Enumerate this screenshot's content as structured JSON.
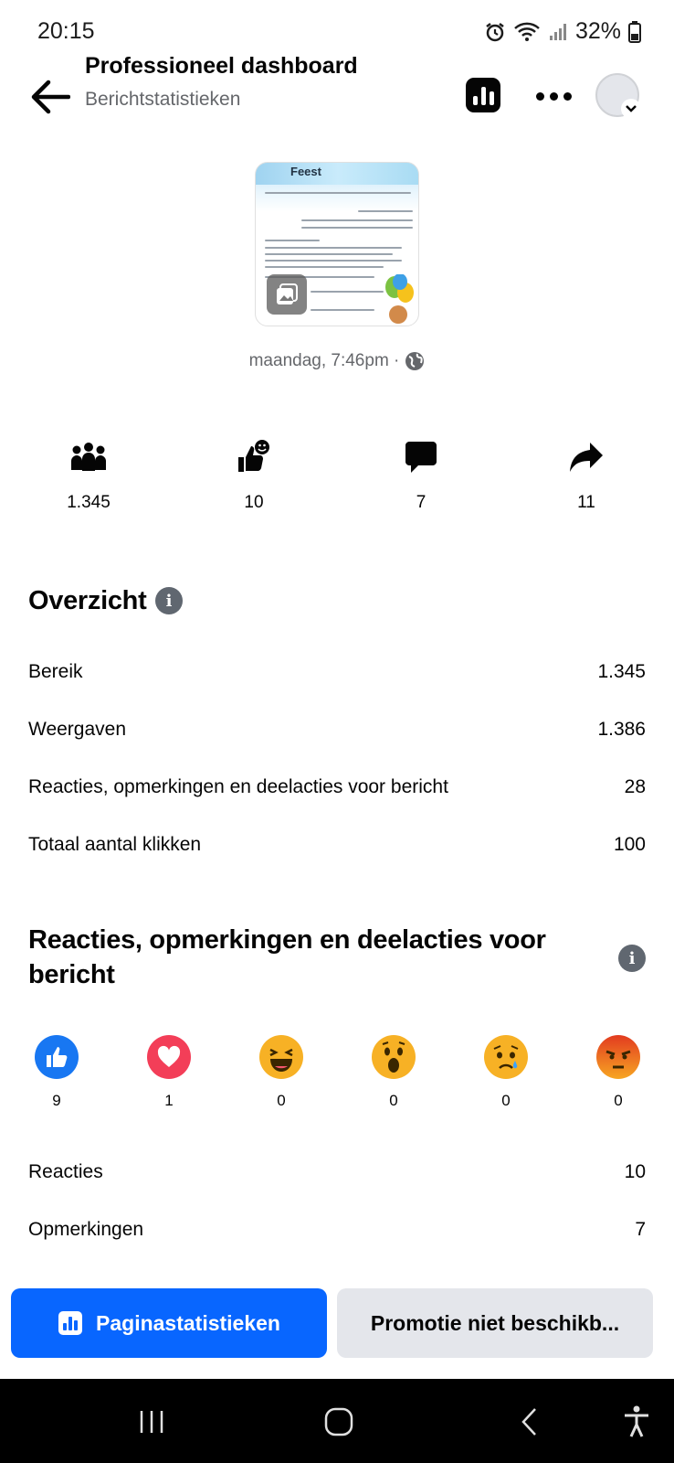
{
  "status_bar": {
    "time": "20:15",
    "battery": "32%"
  },
  "header": {
    "title": "Professioneel dashboard",
    "subtitle": "Berichtstatistieken"
  },
  "post": {
    "thumbnail_title": "Feest",
    "date": "maandag, 7:46pm ·"
  },
  "metrics": [
    {
      "icon": "reach-people-icon",
      "value": "1.345"
    },
    {
      "icon": "reactions-icon",
      "value": "10"
    },
    {
      "icon": "comment-icon",
      "value": "7"
    },
    {
      "icon": "share-icon",
      "value": "11"
    }
  ],
  "overview": {
    "title": "Overzicht",
    "rows": [
      {
        "label": "Bereik",
        "value": "1.345"
      },
      {
        "label": "Weergaven",
        "value": "1.386"
      },
      {
        "label": "Reacties, opmerkingen en deelacties voor bericht",
        "value": "28"
      },
      {
        "label": "Totaal aantal klikken",
        "value": "100"
      }
    ]
  },
  "engagement": {
    "title": "Reacties, opmerkingen en deelacties voor bericht",
    "reactions": [
      {
        "icon": "like-icon",
        "value": "9",
        "color": "#1877f2"
      },
      {
        "icon": "love-icon",
        "value": "1",
        "color": "#f33e58"
      },
      {
        "icon": "haha-icon",
        "value": "0",
        "color": "#f7b125"
      },
      {
        "icon": "wow-icon",
        "value": "0",
        "color": "#f7b125"
      },
      {
        "icon": "sad-icon",
        "value": "0",
        "color": "#f7b125"
      },
      {
        "icon": "angry-icon",
        "value": "0",
        "color": "#e9710f"
      }
    ],
    "rows": [
      {
        "label": "Reacties",
        "value": "10"
      },
      {
        "label": "Opmerkingen",
        "value": "7"
      }
    ]
  },
  "buttons": {
    "primary": "Paginastatistieken",
    "secondary": "Promotie niet beschikb..."
  },
  "colors": {
    "accent": "#0866ff",
    "secondary_bg": "#e4e6eb"
  }
}
